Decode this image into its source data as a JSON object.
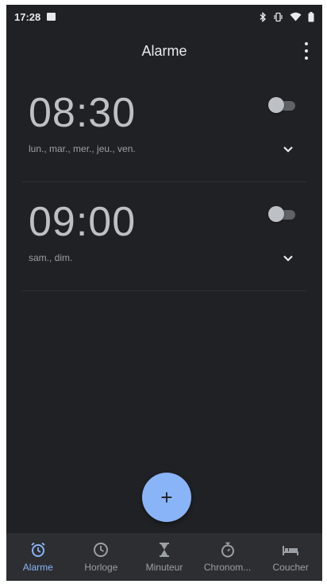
{
  "status_bar": {
    "time": "17:28",
    "icons": [
      "image-notification-icon",
      "bluetooth-icon",
      "vibrate-icon",
      "wifi-icon",
      "battery-icon"
    ]
  },
  "app_bar": {
    "title": "Alarme",
    "menu_icon": "more-vert-icon"
  },
  "alarms": [
    {
      "time": "08:30",
      "days": "lun., mar., mer., jeu., ven.",
      "enabled": false
    },
    {
      "time": "09:00",
      "days": "sam., dim.",
      "enabled": false
    }
  ],
  "fab": {
    "label": "+",
    "icon": "add-icon"
  },
  "bottom_nav": {
    "items": [
      {
        "label": "Alarme",
        "icon": "alarm-icon",
        "active": true
      },
      {
        "label": "Horloge",
        "icon": "clock-icon",
        "active": false
      },
      {
        "label": "Minuteur",
        "icon": "hourglass-icon",
        "active": false
      },
      {
        "label": "Chronom...",
        "icon": "stopwatch-icon",
        "active": false
      },
      {
        "label": "Coucher",
        "icon": "bed-icon",
        "active": false
      }
    ]
  },
  "colors": {
    "background": "#202124",
    "accent": "#8ab4f8",
    "nav_background": "#2d2e31",
    "text_primary": "#e8eaed",
    "text_secondary": "#9aa0a6"
  }
}
